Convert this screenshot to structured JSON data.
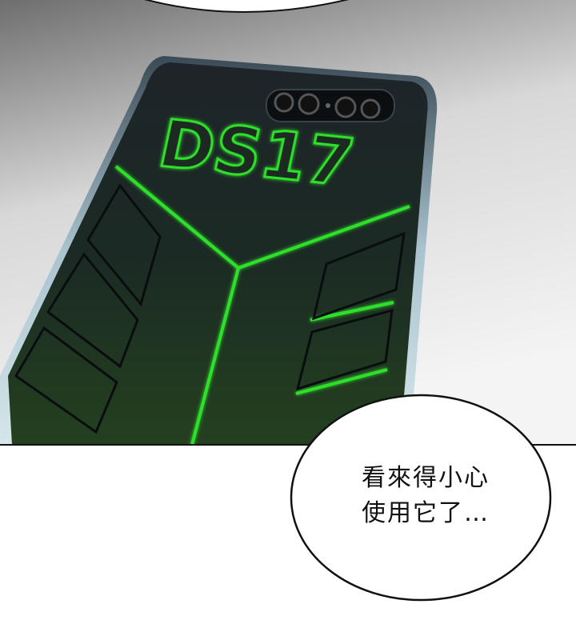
{
  "device": {
    "model_label": "DS17",
    "accent_color": "#2fe02a",
    "body_color": "#1c2328",
    "frame_color": "#9fb4bf"
  },
  "speech_bubble": {
    "lines": [
      "看來得小心",
      "使用它了…"
    ]
  },
  "colors": {
    "background_top": "#7a7a7a",
    "background_bottom": "#f2f2f2",
    "page": "#ffffff",
    "ink": "#111111"
  }
}
